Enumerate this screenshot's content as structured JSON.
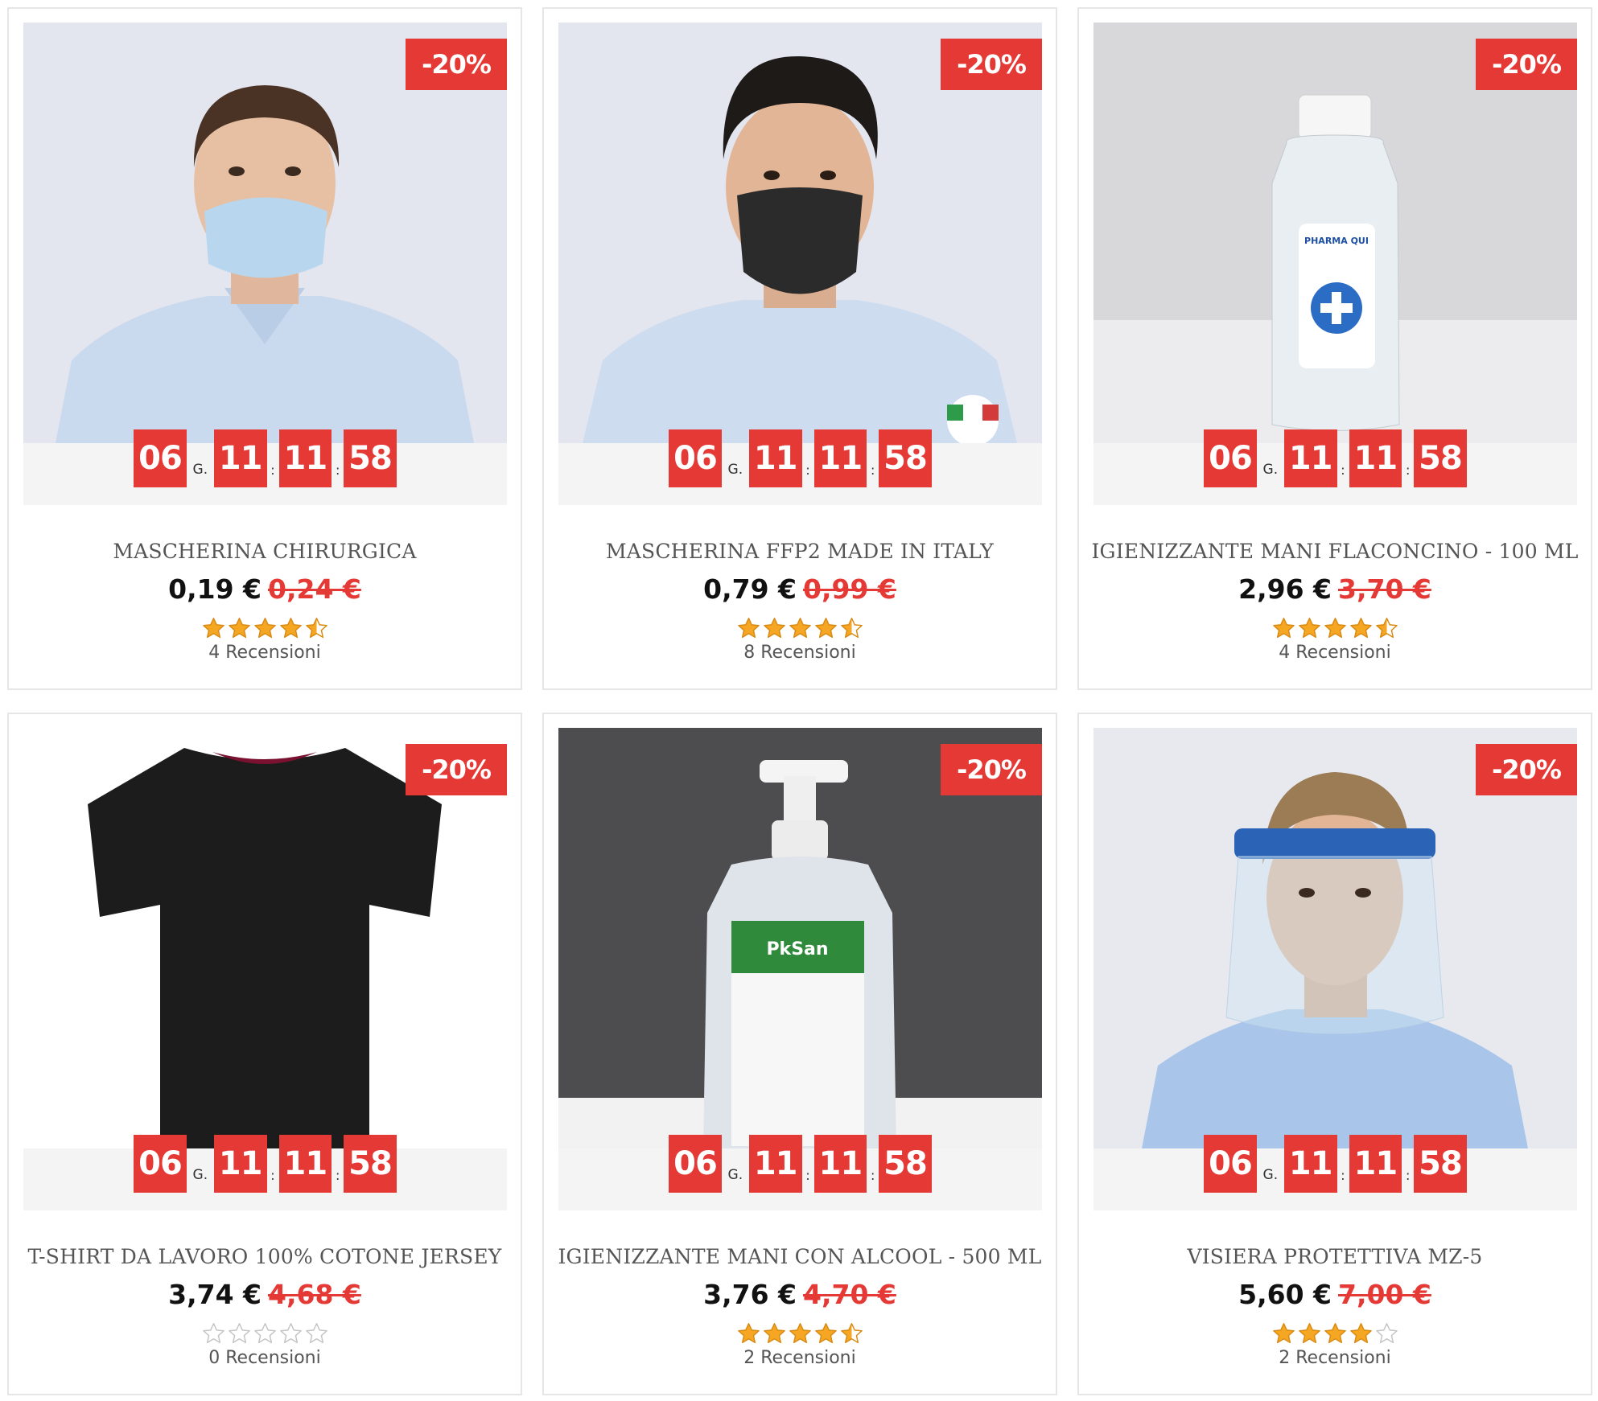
{
  "colors": {
    "accent": "#e53935",
    "star": "#f5a623",
    "star_empty": "#d9d9d9"
  },
  "countdown_labels": {
    "days_suffix": "G.",
    "separator": ":"
  },
  "products": [
    {
      "name": "MASCHERINA CHIRURGICA",
      "price": "0,19 €",
      "old_price": "0,24 €",
      "discount": "-20%",
      "countdown": {
        "days": "06",
        "hours": "11",
        "minutes": "11",
        "seconds": "58"
      },
      "rating": 4.5,
      "reviews": "4 Recensioni",
      "image": "man-surgical-mask"
    },
    {
      "name": "MASCHERINA FFP2 MADE IN ITALY",
      "price": "0,79 €",
      "old_price": "0,99 €",
      "discount": "-20%",
      "countdown": {
        "days": "06",
        "hours": "11",
        "minutes": "11",
        "seconds": "58"
      },
      "rating": 4.5,
      "reviews": "8 Recensioni",
      "image": "man-black-ffp2-mask"
    },
    {
      "name": "IGIENIZZANTE MANI FLACONCINO - 100 ML",
      "price": "2,96 €",
      "old_price": "3,70 €",
      "discount": "-20%",
      "countdown": {
        "days": "06",
        "hours": "11",
        "minutes": "11",
        "seconds": "58"
      },
      "rating": 4.5,
      "reviews": "4 Recensioni",
      "image": "hand-sanitizer-small-bottle"
    },
    {
      "name": "T-SHIRT DA LAVORO 100% COTONE JERSEY",
      "price": "3,74 €",
      "old_price": "4,68 €",
      "discount": "-20%",
      "countdown": {
        "days": "06",
        "hours": "11",
        "minutes": "11",
        "seconds": "58"
      },
      "rating": 0,
      "reviews": "0 Recensioni",
      "image": "black-tshirt"
    },
    {
      "name": "IGIENIZZANTE MANI CON ALCOOL - 500 ML",
      "price": "3,76 €",
      "old_price": "4,70 €",
      "discount": "-20%",
      "countdown": {
        "days": "06",
        "hours": "11",
        "minutes": "11",
        "seconds": "58"
      },
      "rating": 4.5,
      "reviews": "2 Recensioni",
      "image": "hand-sanitizer-pump-bottle"
    },
    {
      "name": "VISIERA PROTETTIVA MZ-5",
      "price": "5,60 €",
      "old_price": "7,00 €",
      "discount": "-20%",
      "countdown": {
        "days": "06",
        "hours": "11",
        "minutes": "11",
        "seconds": "58"
      },
      "rating": 4,
      "reviews": "2 Recensioni",
      "image": "man-face-shield"
    }
  ]
}
